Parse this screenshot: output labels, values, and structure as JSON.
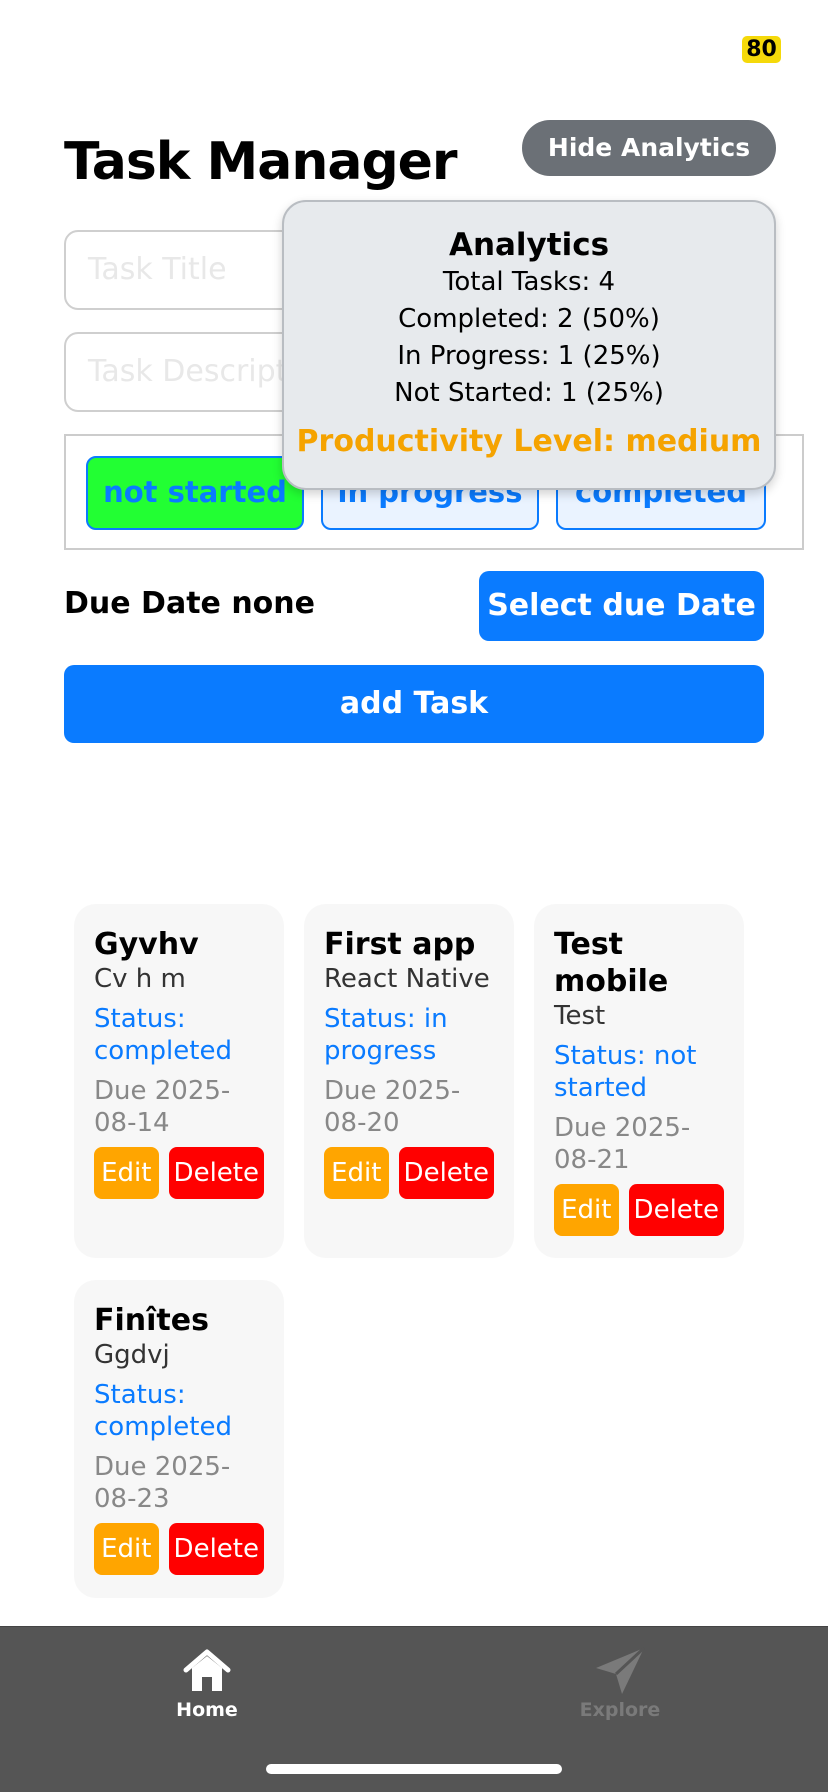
{
  "status_bar": {
    "badge": "80"
  },
  "header": {
    "title": "Task Manager",
    "hide_analytics_label": "Hide Analytics"
  },
  "form": {
    "title_placeholder": "Task Title",
    "description_placeholder": "Task Description",
    "status_options": [
      "not started",
      "in progress",
      "completed"
    ],
    "selected_status": "not started",
    "due_label": "Due Date none",
    "select_due_label": "Select due Date",
    "add_task_label": "add Task"
  },
  "analytics": {
    "title": "Analytics",
    "total": "Total Tasks: 4",
    "completed": "Completed: 2 (50%)",
    "in_progress": "In Progress: 1 (25%)",
    "not_started": "Not Started: 1 (25%)",
    "productivity": "Productivity Level: medium",
    "productivity_color": "#f5a300"
  },
  "tasks": [
    {
      "title": "Gyvhv",
      "description": "Cv h m",
      "status": "Status: completed",
      "due": "Due 2025-08-14",
      "edit": "Edit",
      "delete": "Delete"
    },
    {
      "title": "First app",
      "description": "React Native",
      "status": "Status: in progress",
      "due": "Due 2025-08-20",
      "edit": "Edit",
      "delete": "Delete"
    },
    {
      "title": "Test mobile",
      "description": "Test",
      "status": "Status: not started",
      "due": "Due 2025-08-21",
      "edit": "Edit",
      "delete": "Delete"
    },
    {
      "title": "Finîtes",
      "description": "Ggdvj",
      "status": "Status: completed",
      "due": "Due 2025-08-23",
      "edit": "Edit",
      "delete": "Delete"
    }
  ],
  "tabbar": {
    "home_label": "Home",
    "home_icon": "home-icon",
    "explore_label": "Explore",
    "explore_icon": "paper-plane-icon"
  },
  "colors": {
    "accent": "#0a7bff",
    "active_status": "#22ff33",
    "edit": "#ffa500",
    "delete": "#ff0000",
    "tabbar": "#555555"
  }
}
